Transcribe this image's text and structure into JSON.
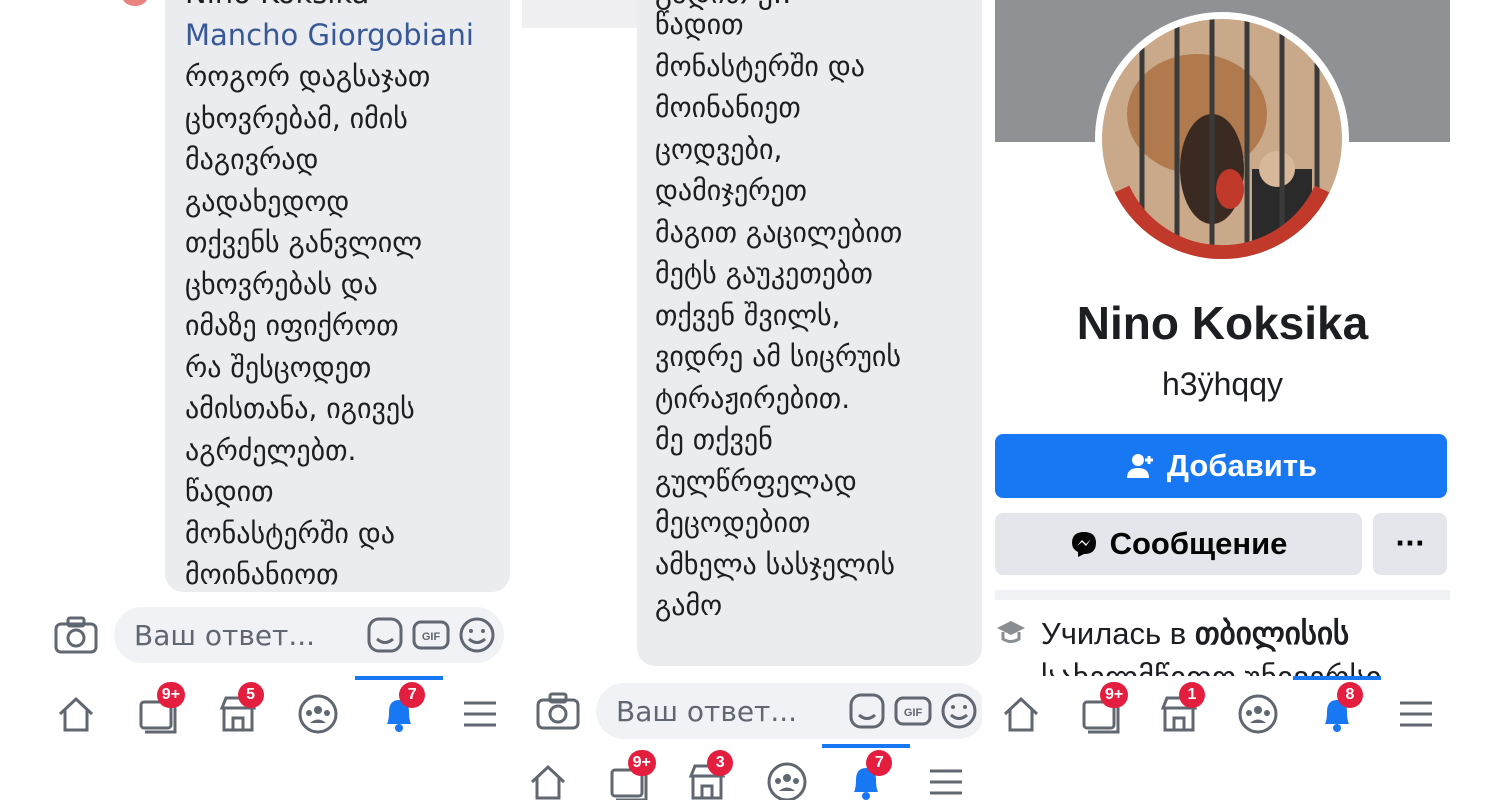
{
  "panel1": {
    "author_top": "Nino Koksika",
    "author": "Mancho Giorgobiani",
    "lines": [
      "როგორ დაგსაჯათ",
      "ცხოვრებამ, იმის",
      "მაგივრად",
      "გადახედოდ",
      "თქვენს განვლილ",
      "ცხოვრებას და",
      "იმაზე იფიქროთ",
      "რა შესცოდეთ",
      "ამისთანა, იგივეს",
      "აგრძელებთ.",
      "წადით",
      "მონასტერში და",
      "მოინანიოთ"
    ],
    "reply_placeholder": "Ваш ответ...",
    "nav_badges": {
      "friends": "9+",
      "marketplace": "5",
      "notifications": "7"
    }
  },
  "panel2": {
    "partial_line": "გადით უ..",
    "lines": [
      "წადით",
      "მონასტერში და",
      "მოინანიეთ",
      "ცოდვები,",
      "დამიჯერეთ",
      "მაგით გაცილებით",
      "მეტს გაუკეთებთ",
      "თქვენ შვილს,",
      "ვიდრე ამ სიცრუის",
      "ტირაჟირებით.",
      "მე თქვენ",
      "გულწრფელად",
      "მეცოდებით",
      "ამხელა სასჯელის",
      "გამო"
    ],
    "reply_placeholder": "Ваш ответ...",
    "nav_badges": {
      "friends": "9+",
      "marketplace": "3",
      "notifications": "7"
    }
  },
  "panel3": {
    "profile_name": "Nino Koksika",
    "alternate_name": "h3ÿhqqy",
    "add_button": "Добавить",
    "message_button": "Сообщение",
    "more_button": "···",
    "education_prefix": "Училась в ",
    "education_place": "თბილისის",
    "education_next": "სახელმწიფო უნივერსი",
    "nav_badges": {
      "friends": "9+",
      "marketplace": "1",
      "notifications": "8"
    }
  },
  "icons": [
    "camera-icon",
    "sticker-icon",
    "gif-icon",
    "emoji-icon",
    "home-icon",
    "friends-icon",
    "marketplace-icon",
    "groups-icon",
    "notifications-icon",
    "menu-icon",
    "add-friend-icon",
    "messenger-icon",
    "education-icon"
  ],
  "colors": {
    "link": "#385898",
    "primary_button": "#1877f2",
    "badge": "#e41e3f",
    "bubble": "#ebecf0",
    "secondary_button": "#e4e6eb"
  }
}
